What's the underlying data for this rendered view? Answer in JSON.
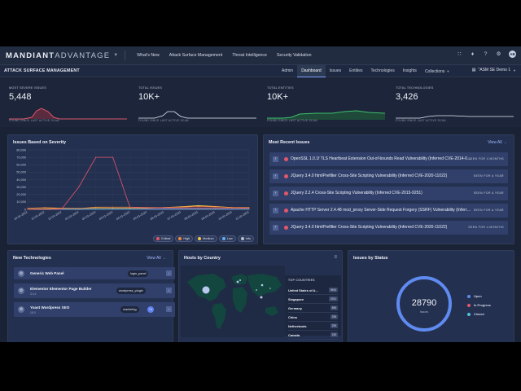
{
  "topbar": {
    "brand_bold": "MANDIANT",
    "brand_light": "ADVANTAGE",
    "nav": [
      "What's New",
      "Attack Surface Management",
      "Threat Intelligence",
      "Security Validation"
    ],
    "avatar": "AB"
  },
  "subbar": {
    "title": "ATTACK SURFACE MANAGEMENT",
    "tabs": [
      "Admin",
      "Dashboard",
      "Issues",
      "Entities",
      "Technologies",
      "Insights",
      "Collections"
    ],
    "active_tab": "Dashboard",
    "workspace": "\"ASM SE Demo 1"
  },
  "metrics": [
    {
      "label": "MOST SEVERE ISSUES",
      "value": "5,448",
      "foot": "FOUND SINCE LAST ACTIVE SCAN",
      "color": "#d9566b"
    },
    {
      "label": "TOTAL ISSUES",
      "value": "10K+",
      "foot": "FOUND SINCE LAST ACTIVE SCAN",
      "color": "#e8eefc"
    },
    {
      "label": "TOTAL ENTITIES",
      "value": "10K+",
      "foot": "FOUND SINCE LAST ACTIVE SCAN",
      "color": "#3fbf6e"
    },
    {
      "label": "TOTAL TECHNOLOGIES",
      "value": "3,426",
      "foot": "FOUND SINCE LAST ACTIVE SCAN",
      "color": "#e8eefc"
    }
  ],
  "severity_panel": {
    "title": "Issues Based on Severity",
    "legend": [
      {
        "name": "Critical",
        "color": "#e4566b"
      },
      {
        "name": "High",
        "color": "#f08a3c"
      },
      {
        "name": "Medium",
        "color": "#f3c84b"
      },
      {
        "name": "Low",
        "color": "#5fb0f5"
      },
      {
        "name": "Info",
        "color": "#b8c0d0"
      }
    ]
  },
  "chart_data": {
    "type": "line",
    "title": "Issues Based on Severity",
    "categories": [
      "10-01-2022",
      "11-01-2022",
      "12-01-2022",
      "01-01-2023",
      "02-01-2023",
      "03-01-2023",
      "04-01-2023",
      "05-01-2023",
      "06-01-2023",
      "07-01-2023",
      "08-01-2023",
      "09-01-2023",
      "10-01-2023",
      "11-01-2023"
    ],
    "ylim": [
      0,
      80000
    ],
    "yticks": [
      "0",
      "10,000",
      "20,000",
      "30,000",
      "40,000",
      "50,000",
      "60,000",
      "70,000",
      "80,000"
    ],
    "grid": true,
    "series": [
      {
        "name": "Critical",
        "color": "#e4566b",
        "values": [
          0,
          0,
          500,
          30000,
          70000,
          70000,
          3000,
          2000,
          2000,
          2000,
          2000,
          2000,
          1500,
          1500
        ]
      },
      {
        "name": "High",
        "color": "#f08a3c",
        "values": [
          1500,
          2500,
          1500,
          1000,
          3000,
          3000,
          3000,
          2500,
          2500,
          3000,
          4000,
          3500,
          2500,
          2500
        ]
      },
      {
        "name": "Medium",
        "color": "#f3c84b",
        "values": [
          300,
          800,
          1500,
          1200,
          2000,
          1800,
          1500,
          1500,
          2500,
          3500,
          5000,
          4000,
          2500,
          2000
        ]
      },
      {
        "name": "Low",
        "color": "#5fb0f5",
        "values": [
          100,
          100,
          200,
          200,
          300,
          300,
          300,
          300,
          400,
          400,
          400,
          400,
          300,
          300
        ]
      },
      {
        "name": "Info",
        "color": "#b8c0d0",
        "values": [
          50,
          50,
          100,
          100,
          150,
          150,
          150,
          150,
          200,
          200,
          200,
          200,
          150,
          150
        ]
      }
    ]
  },
  "recent_issues": {
    "title": "Most Recent Issues",
    "view_all": "View All",
    "items": [
      {
        "text": "OpenSSL 1.0.1f TLS Heartbeat Extension Out-of-bounds Read Vulnerability (Inferred CVE-2014-0160)",
        "seen": "SEEN FOR 4 MONTHS"
      },
      {
        "text": "JQuery 3.4.0 htmlPrefilter Cross-Site Scripting Vulnerability (Inferred CVE-2020-11022)",
        "seen": "SEEN FOR A YEAR"
      },
      {
        "text": "JQuery 2.2.4 Cross-Site Scripting Vulnerability (Inferred CVE-2015-9251)",
        "seen": "SEEN FOR A YEAR"
      },
      {
        "text": "Apache HTTP Server 2.4.48 mod_proxy Server-Side Request Forgery (SSRF) Vulnerability (Inferred CVE-2021-40438)",
        "seen": "SEEN FOR A YEAR"
      },
      {
        "text": "JQuery 3.4.0 htmlPrefilter Cross-Site Scripting Vulnerability (Inferred CVE-2020-11022)",
        "seen": "SEEN FOR 4 MONTHS"
      }
    ]
  },
  "new_tech": {
    "title": "New Technologies",
    "view_all": "View All",
    "items": [
      {
        "name": "Generic Web Panel",
        "version": "",
        "tag": "login_panel",
        "plus": ""
      },
      {
        "name": "Elementor Elementor Page Builder",
        "version": "3.4.2",
        "tag": "wordpress_plugin",
        "plus": ""
      },
      {
        "name": "Yoast Wordpress SEO",
        "version": "15.0",
        "tag": "marketing",
        "plus": "+1"
      }
    ]
  },
  "hosts": {
    "title": "Hosts by Country",
    "top_title": "TOP COUNTRIES",
    "countries": [
      {
        "name": "United States of A...",
        "value": "9634"
      },
      {
        "name": "Singapore",
        "value": "2331"
      },
      {
        "name": "Germany",
        "value": "896"
      },
      {
        "name": "China",
        "value": "298"
      },
      {
        "name": "Netherlands",
        "value": "299"
      },
      {
        "name": "Canada",
        "value": "155"
      }
    ]
  },
  "status": {
    "title": "Issues by Status",
    "total": "28790",
    "total_label": "Issues",
    "legend": [
      {
        "name": "Open",
        "color": "#5f8bf0"
      },
      {
        "name": "In Progress",
        "color": "#e4566b"
      },
      {
        "name": "Closed",
        "color": "#4fc3d6"
      }
    ]
  }
}
